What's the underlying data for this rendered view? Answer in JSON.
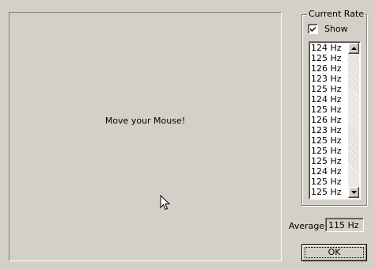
{
  "mouse_area": {
    "label": "Move your Mouse!"
  },
  "current_rate": {
    "title": "Current Rate",
    "show_label": "Show",
    "show_checked": true,
    "items": [
      "124 Hz",
      "125 Hz",
      "126 Hz",
      "123 Hz",
      "125 Hz",
      "124 Hz",
      "125 Hz",
      "126 Hz",
      "123 Hz",
      "125 Hz",
      "125 Hz",
      "125 Hz",
      "124 Hz",
      "125 Hz",
      "125 Hz"
    ]
  },
  "average": {
    "label": "Average",
    "value": "115 Hz"
  },
  "ok_button": {
    "label": "OK"
  }
}
